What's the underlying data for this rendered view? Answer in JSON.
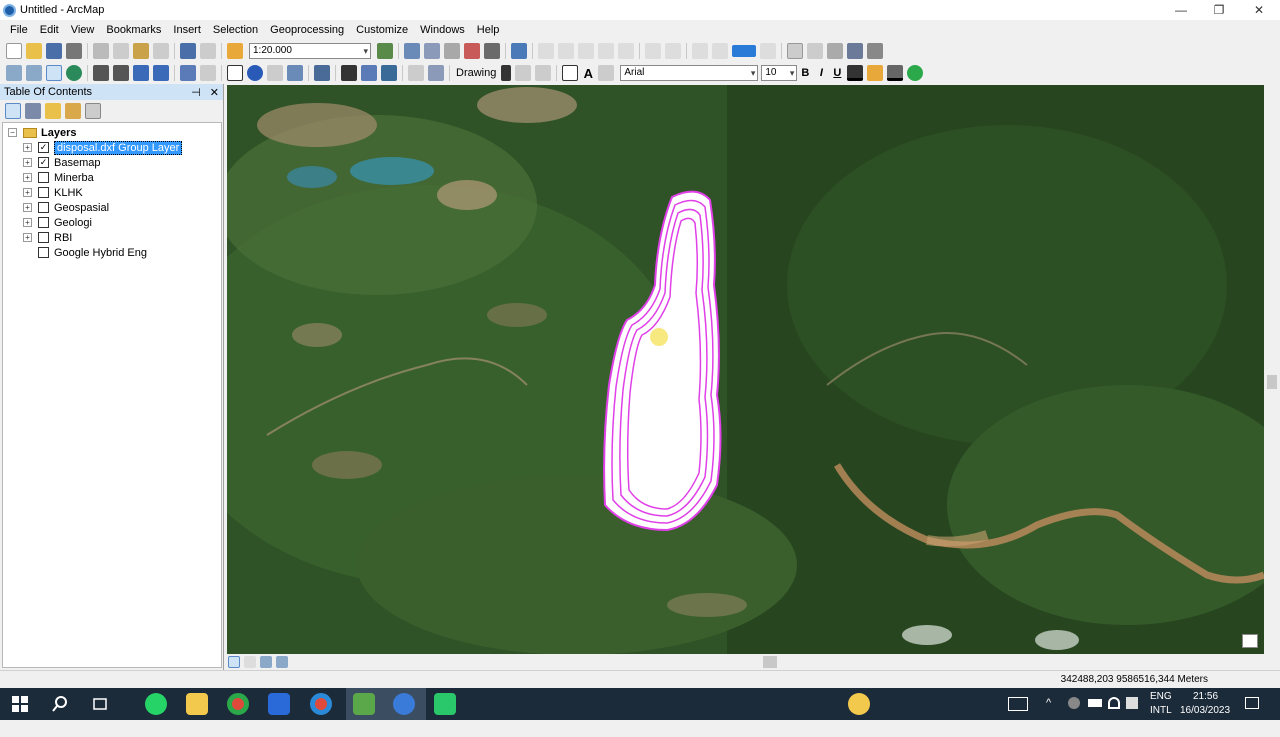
{
  "window": {
    "title": "Untitled - ArcMap",
    "minimize": "—",
    "restore": "❐",
    "close": "✕"
  },
  "menu": [
    "File",
    "Edit",
    "View",
    "Bookmarks",
    "Insert",
    "Selection",
    "Geoprocessing",
    "Customize",
    "Windows",
    "Help"
  ],
  "toolbar": {
    "scale": "1:20.000",
    "drawing_label": "Drawing",
    "font_name": "Arial",
    "font_size": "10",
    "bold": "B",
    "italic": "I",
    "underline": "U",
    "text_tool": "A"
  },
  "toc": {
    "title": "Table Of Contents",
    "pin": "⊣",
    "close": "✕",
    "root": "Layers",
    "layers": [
      {
        "name": "disposal.dxf Group Layer",
        "checked": true,
        "expandable": true,
        "selected": true
      },
      {
        "name": "Basemap",
        "checked": true,
        "expandable": true,
        "selected": false
      },
      {
        "name": "Minerba",
        "checked": false,
        "expandable": true,
        "selected": false
      },
      {
        "name": "KLHK",
        "checked": false,
        "expandable": true,
        "selected": false
      },
      {
        "name": "Geospasial",
        "checked": false,
        "expandable": true,
        "selected": false
      },
      {
        "name": "Geologi",
        "checked": false,
        "expandable": true,
        "selected": false
      },
      {
        "name": "RBI",
        "checked": false,
        "expandable": true,
        "selected": false
      },
      {
        "name": "Google Hybrid Eng",
        "checked": false,
        "expandable": false,
        "selected": false
      }
    ]
  },
  "status": {
    "coordinates": "342488,203  9586516,344 Meters"
  },
  "taskbar": {
    "lang_top": "ENG",
    "lang_bottom": "INTL",
    "time": "21:56",
    "date": "16/03/2023"
  },
  "colors": {
    "accent": "#3399ff",
    "polygon_outline": "#e040e8",
    "taskbar": "#1c2b3a"
  },
  "icons": [
    "search-icon",
    "task-view-icon",
    "whatsapp-icon",
    "file-explorer-icon",
    "chrome-icon",
    "arcmap-icon",
    "help-icon",
    "notification-icon"
  ]
}
